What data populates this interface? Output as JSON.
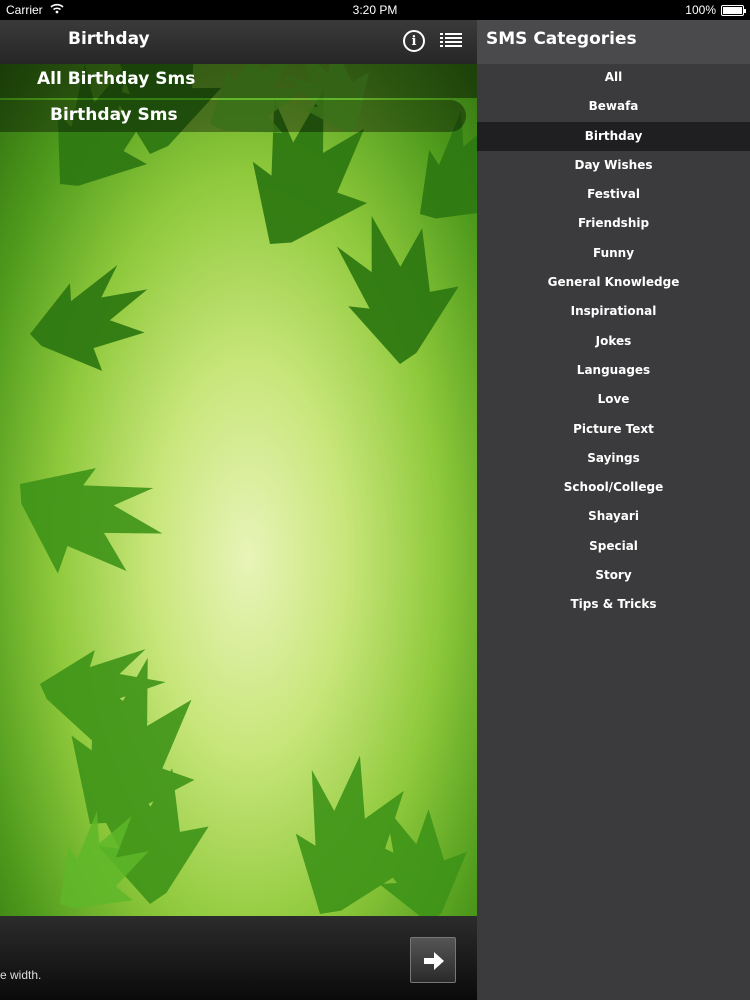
{
  "status_bar": {
    "carrier": "Carrier",
    "time": "3:20 PM",
    "battery": "100%"
  },
  "main": {
    "nav_title": "Birthday",
    "icons": [
      "info-icon",
      "list-icon"
    ],
    "subcategories": [
      "All Birthday Sms",
      "Birthday Sms"
    ],
    "bottom_text": "e width.",
    "next_icon": "arrow-right-icon"
  },
  "sidebar": {
    "title": "SMS Categories",
    "selected": "Birthday",
    "items": [
      "All",
      "Bewafa",
      "Birthday",
      "Day Wishes",
      "Festival",
      "Friendship",
      "Funny",
      "General Knowledge",
      "Inspirational",
      "Jokes",
      "Languages",
      "Love",
      "Picture Text",
      "Sayings",
      "School/College",
      "Shayari",
      "Special",
      "Story",
      "Tips & Tricks"
    ]
  },
  "colors": {
    "sidebar_bg": "#3b3a3c",
    "sidebar_header_bg": "#4a494b",
    "selected_row_bg": "#1f1f21",
    "nav_bar_bg": "#2e2e2e"
  }
}
